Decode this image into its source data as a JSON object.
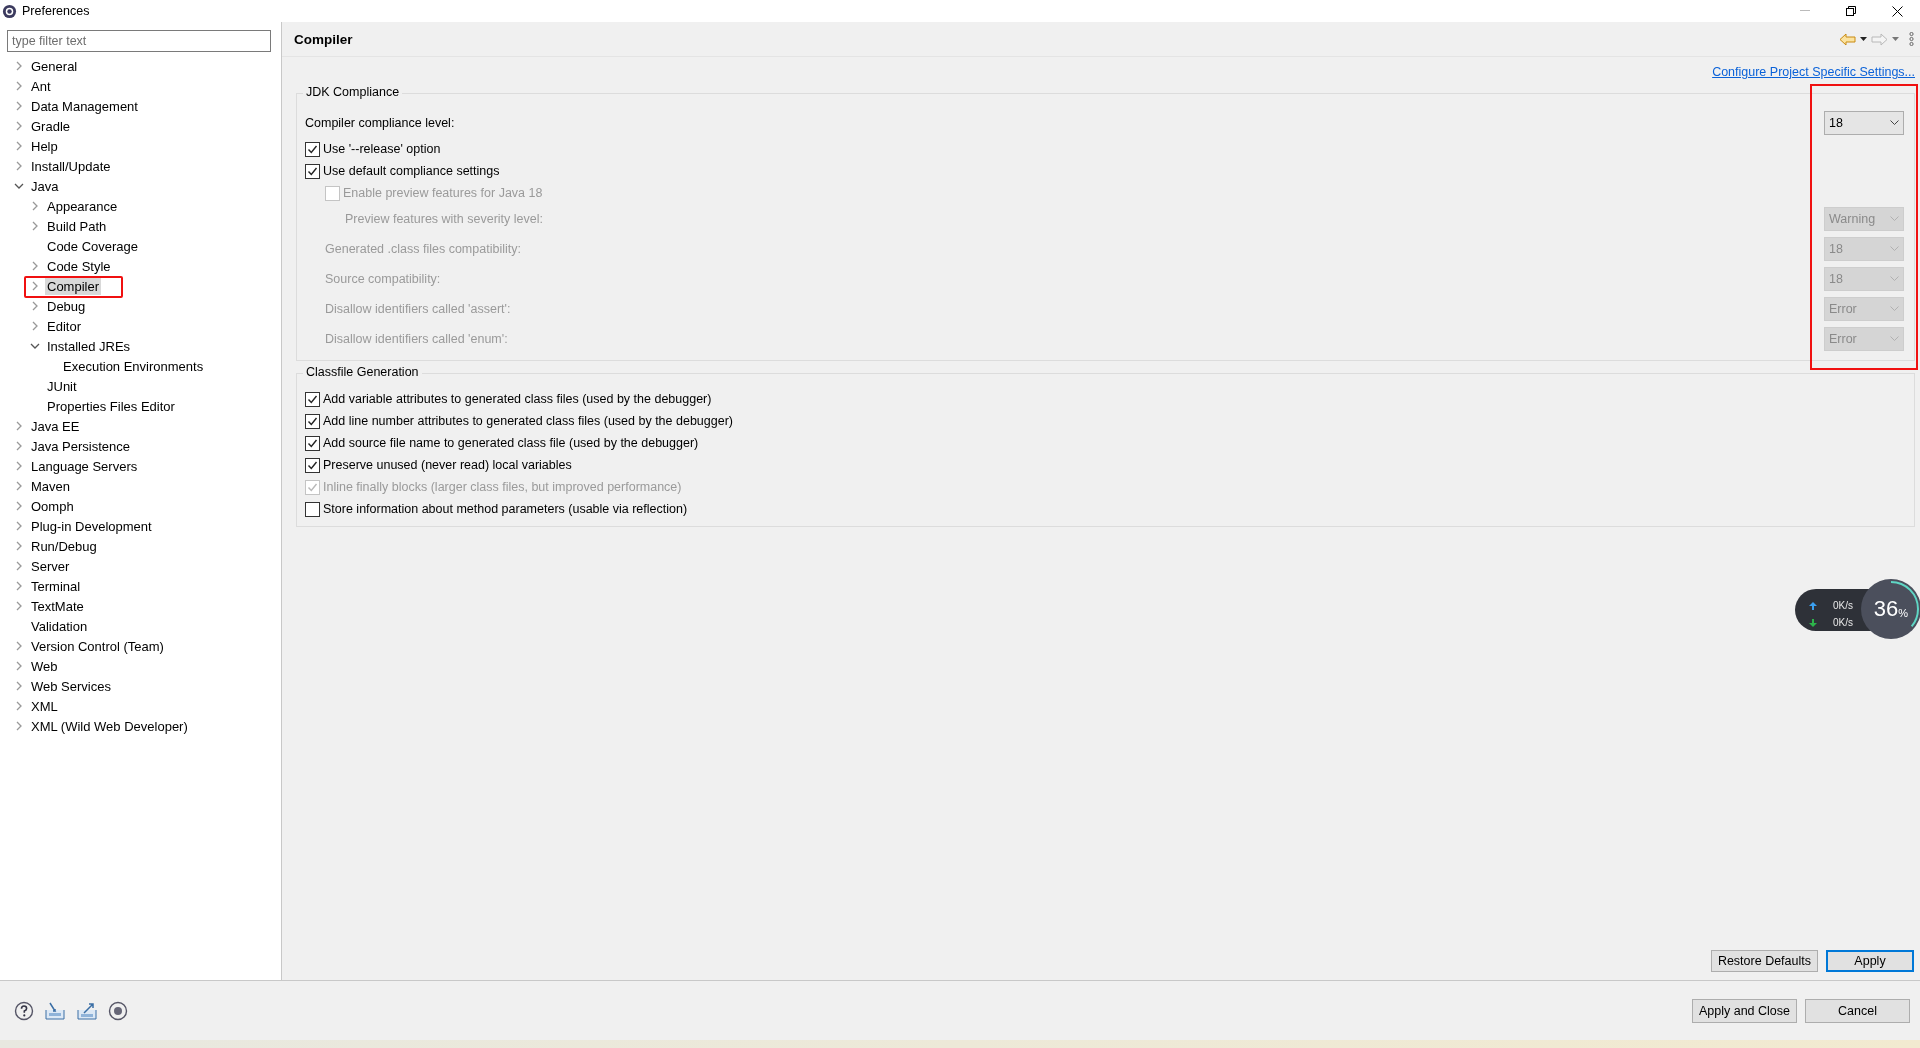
{
  "window": {
    "title": "Preferences"
  },
  "filter": {
    "placeholder": "type filter text"
  },
  "tree": [
    {
      "label": "General",
      "expanded": false,
      "selected": false,
      "highlighted": false
    },
    {
      "label": "Ant",
      "expanded": false,
      "selected": false,
      "highlighted": false
    },
    {
      "label": "Data Management",
      "expanded": false,
      "selected": false,
      "highlighted": false
    },
    {
      "label": "Gradle",
      "expanded": false,
      "selected": false,
      "highlighted": false
    },
    {
      "label": "Help",
      "expanded": false,
      "selected": false,
      "highlighted": false
    },
    {
      "label": "Install/Update",
      "expanded": false,
      "selected": false,
      "highlighted": false
    },
    {
      "label": "Java",
      "expanded": true,
      "selected": false,
      "highlighted": false,
      "children": [
        {
          "label": "Appearance",
          "expanded": false,
          "selected": false,
          "highlighted": false
        },
        {
          "label": "Build Path",
          "expanded": false,
          "selected": false,
          "highlighted": false
        },
        {
          "label": "Code Coverage",
          "selected": false,
          "highlighted": false
        },
        {
          "label": "Code Style",
          "expanded": false,
          "selected": false,
          "highlighted": false
        },
        {
          "label": "Compiler",
          "expanded": false,
          "selected": true,
          "highlighted": true
        },
        {
          "label": "Debug",
          "expanded": false,
          "selected": false,
          "highlighted": false
        },
        {
          "label": "Editor",
          "expanded": false,
          "selected": false,
          "highlighted": false
        },
        {
          "label": "Installed JREs",
          "expanded": true,
          "selected": false,
          "highlighted": false,
          "children": [
            {
              "label": "Execution Environments",
              "selected": false,
              "highlighted": false
            }
          ]
        },
        {
          "label": "JUnit",
          "selected": false,
          "highlighted": false
        },
        {
          "label": "Properties Files Editor",
          "selected": false,
          "highlighted": false
        }
      ]
    },
    {
      "label": "Java EE",
      "expanded": false,
      "selected": false,
      "highlighted": false
    },
    {
      "label": "Java Persistence",
      "expanded": false,
      "selected": false,
      "highlighted": false
    },
    {
      "label": "Language Servers",
      "expanded": false,
      "selected": false,
      "highlighted": false
    },
    {
      "label": "Maven",
      "expanded": false,
      "selected": false,
      "highlighted": false
    },
    {
      "label": "Oomph",
      "expanded": false,
      "selected": false,
      "highlighted": false
    },
    {
      "label": "Plug-in Development",
      "expanded": false,
      "selected": false,
      "highlighted": false
    },
    {
      "label": "Run/Debug",
      "expanded": false,
      "selected": false,
      "highlighted": false
    },
    {
      "label": "Server",
      "expanded": false,
      "selected": false,
      "highlighted": false
    },
    {
      "label": "Terminal",
      "expanded": false,
      "selected": false,
      "highlighted": false
    },
    {
      "label": "TextMate",
      "expanded": false,
      "selected": false,
      "highlighted": false
    },
    {
      "label": "Validation",
      "selected": false,
      "highlighted": false
    },
    {
      "label": "Version Control (Team)",
      "expanded": false,
      "selected": false,
      "highlighted": false
    },
    {
      "label": "Web",
      "expanded": false,
      "selected": false,
      "highlighted": false
    },
    {
      "label": "Web Services",
      "expanded": false,
      "selected": false,
      "highlighted": false
    },
    {
      "label": "XML",
      "expanded": false,
      "selected": false,
      "highlighted": false
    },
    {
      "label": "XML (Wild Web Developer)",
      "expanded": false,
      "selected": false,
      "highlighted": false
    }
  ],
  "page": {
    "title": "Compiler",
    "link": "Configure Project Specific Settings...",
    "groups": [
      {
        "title": "JDK Compliance",
        "highlighted": true,
        "rows": [
          {
            "kind": "dropdown",
            "label": "Compiler compliance level:",
            "value": "18",
            "disabled": false
          },
          {
            "kind": "checkbox",
            "label": "Use '--release' option",
            "checked": true,
            "disabled": false
          },
          {
            "kind": "checkbox",
            "label": "Use default compliance settings",
            "checked": true,
            "disabled": false,
            "children": [
              {
                "kind": "checkbox",
                "label": "Enable preview features for Java 18",
                "checked": false,
                "disabled": true,
                "children": [
                  {
                    "kind": "dropdown",
                    "label": "Preview features with severity level:",
                    "value": "Warning",
                    "disabled": true
                  }
                ]
              },
              {
                "kind": "dropdown",
                "label": "Generated .class files compatibility:",
                "value": "18",
                "disabled": true
              },
              {
                "kind": "dropdown",
                "label": "Source compatibility:",
                "value": "18",
                "disabled": true
              },
              {
                "kind": "dropdown",
                "label": "Disallow identifiers called 'assert':",
                "value": "Error",
                "disabled": true
              },
              {
                "kind": "dropdown",
                "label": "Disallow identifiers called 'enum':",
                "value": "Error",
                "disabled": true
              }
            ]
          }
        ]
      },
      {
        "title": "Classfile Generation",
        "highlighted": false,
        "rows": [
          {
            "kind": "checkbox",
            "label": "Add variable attributes to generated class files (used by the debugger)",
            "checked": true,
            "disabled": false
          },
          {
            "kind": "checkbox",
            "label": "Add line number attributes to generated class files (used by the debugger)",
            "checked": true,
            "disabled": false
          },
          {
            "kind": "checkbox",
            "label": "Add source file name to generated class file (used by the debugger)",
            "checked": true,
            "disabled": false
          },
          {
            "kind": "checkbox",
            "label": "Preserve unused (never read) local variables",
            "checked": true,
            "disabled": false
          },
          {
            "kind": "checkbox",
            "label": "Inline finally blocks (larger class files, but improved performance)",
            "checked": true,
            "disabled": true
          },
          {
            "kind": "checkbox",
            "label": "Store information about method parameters (usable via reflection)",
            "checked": false,
            "disabled": false
          }
        ]
      }
    ],
    "buttons": [
      {
        "label": "Restore Defaults",
        "default": false
      },
      {
        "label": "Apply",
        "default": true
      }
    ]
  },
  "footer_buttons": [
    {
      "label": "Apply and Close"
    },
    {
      "label": "Cancel"
    }
  ],
  "net_widget": {
    "upload": "0K/s",
    "download": "0K/s",
    "percent": "36",
    "unit": "%",
    "level": 0.36
  }
}
